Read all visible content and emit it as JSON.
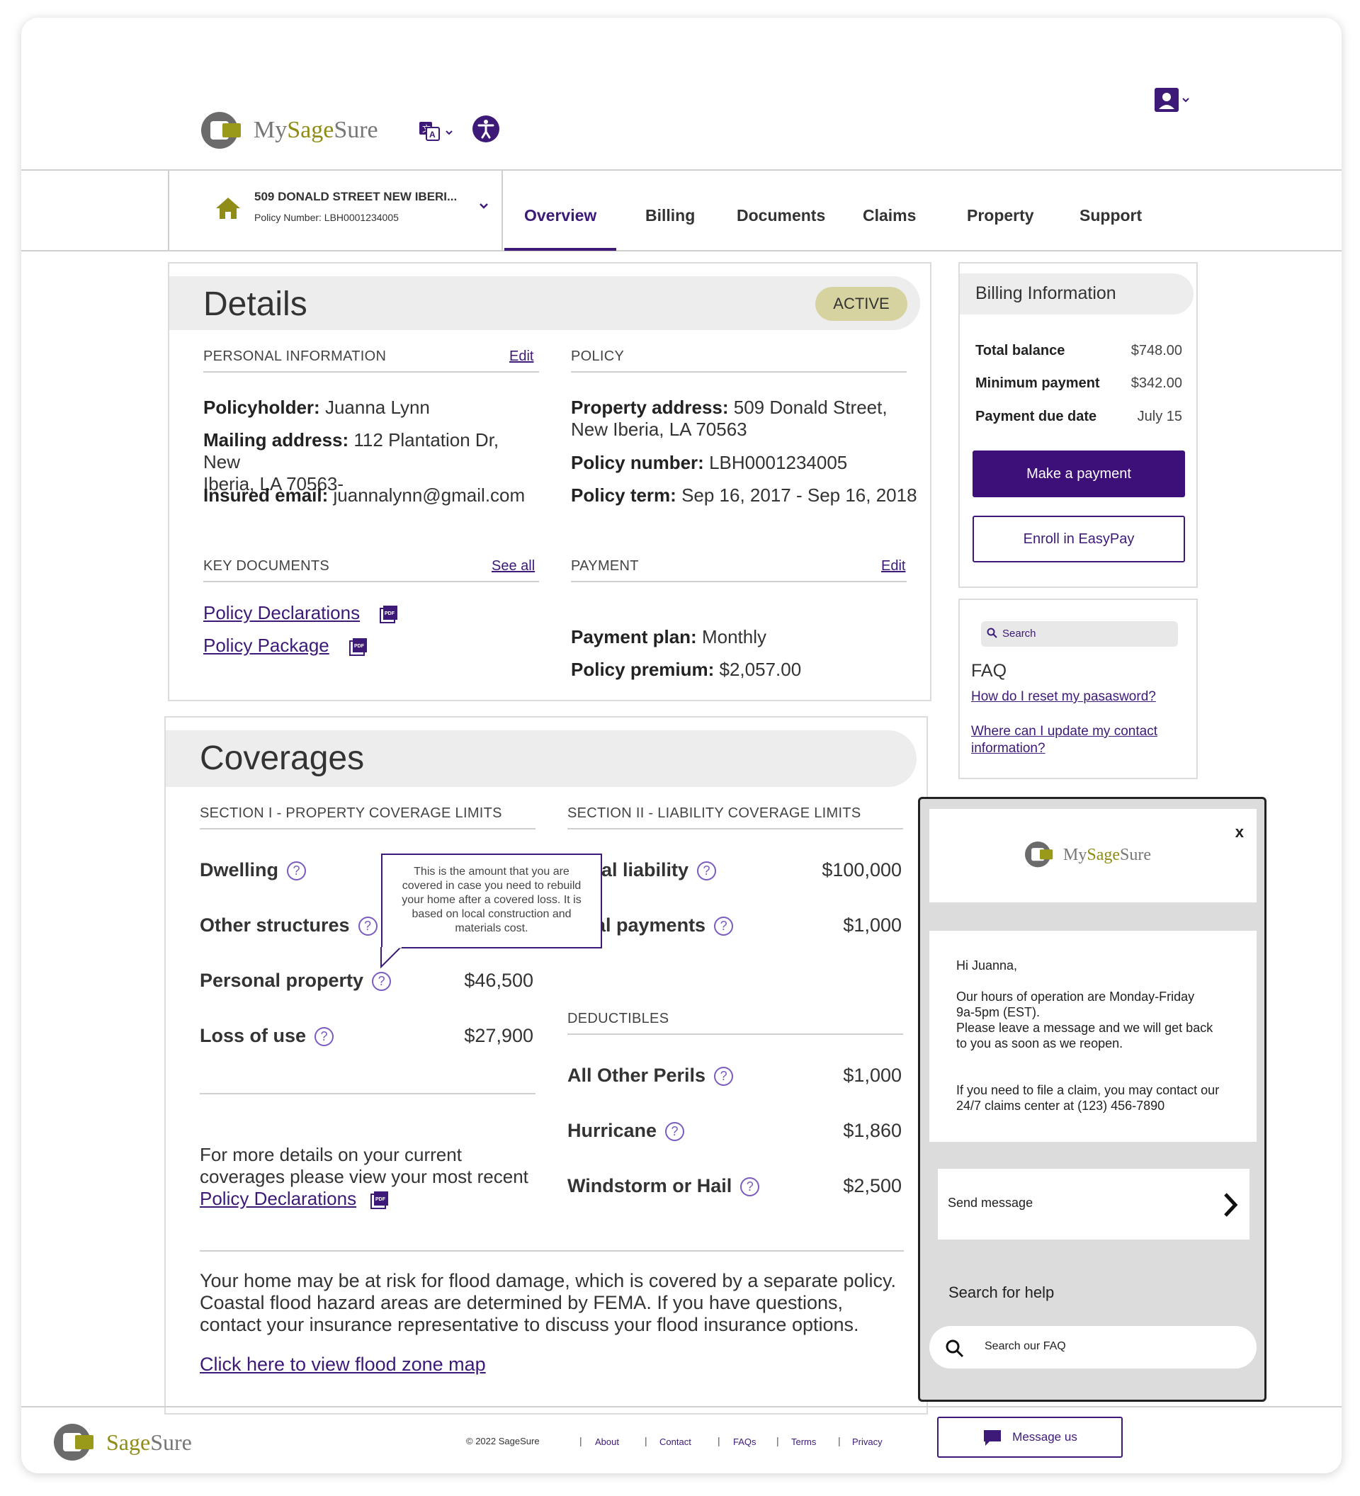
{
  "header": {
    "logo_my": "My",
    "logo_sage": "Sage",
    "logo_sure": "Sure"
  },
  "policy_selector": {
    "address": "509 DONALD STREET NEW IBERI...",
    "policy_number": "Policy Number: LBH0001234005"
  },
  "tabs": [
    {
      "label": "Overview",
      "active": true
    },
    {
      "label": "Billing"
    },
    {
      "label": "Documents"
    },
    {
      "label": "Claims"
    },
    {
      "label": "Property"
    },
    {
      "label": "Support"
    }
  ],
  "details": {
    "title": "Details",
    "status": "ACTIVE",
    "personal": {
      "heading": "PERSONAL INFORMATION",
      "edit": "Edit",
      "policyholder_label": "Policyholder:",
      "policyholder": "Juanna Lynn",
      "mailing_label": "Mailing address:",
      "mailing_1": "112 Plantation Dr, New",
      "mailing_2": "Iberia, LA 70563-",
      "email_label": "Insured email:",
      "email": "juannalynn@gmail.com"
    },
    "policy": {
      "heading": "POLICY",
      "address_label": "Property address:",
      "address_1": "509 Donald Street,",
      "address_2": "New Iberia, LA 70563",
      "number_label": "Policy number:",
      "number": "LBH0001234005",
      "term_label": "Policy term:",
      "term": "Sep 16, 2017 - Sep 16, 2018"
    },
    "key_documents": {
      "heading": "KEY DOCUMENTS",
      "see_all": "See all",
      "doc1": "Policy Declarations",
      "doc2": "Policy Package"
    },
    "payment": {
      "heading": "PAYMENT",
      "edit": "Edit",
      "plan_label": "Payment plan:",
      "plan": "Monthly",
      "premium_label": "Policy premium:",
      "premium": "$2,057.00"
    }
  },
  "billing": {
    "title": "Billing Information",
    "total_label": "Total balance",
    "total": "$748.00",
    "min_label": "Minimum payment",
    "min": "$342.00",
    "due_label": "Payment due date",
    "due": "July 15",
    "pay_button": "Make a payment",
    "easypay_button": "Enroll in EasyPay"
  },
  "faq": {
    "search_placeholder": "Search",
    "title": "FAQ",
    "q1": "How do I reset my pasasword?",
    "q2_1": "Where can I update my contact",
    "q2_2": "information?"
  },
  "coverages": {
    "title": "Coverages",
    "section1": "SECTION I - PROPERTY COVERAGE LIMITS",
    "section2": "SECTION II - LIABILITY COVERAGE LIMITS",
    "dwelling": "Dwelling",
    "other_structures": "Other structures",
    "personal_property": "Personal property",
    "personal_property_val": "$46,500",
    "loss_of_use": "Loss of use",
    "loss_of_use_val": "$27,900",
    "personal_liability": "sonal liability",
    "personal_liability_val": "$100,000",
    "medical_payments": "dical payments",
    "medical_payments_val": "$1,000",
    "deductibles": "DEDUCTIBLES",
    "aop": "All Other Perils",
    "aop_val": "$1,000",
    "hurricane": "Hurricane",
    "hurricane_val": "$1,860",
    "wind": "Windstorm or Hail",
    "wind_val": "$2,500",
    "tooltip": "This is the amount that you are covered in case you need to rebuild your home after a covered loss. It is based on local construction and materials cost.",
    "more_1": "For more details on your current",
    "more_2": "coverages please view your most recent",
    "more_link": "Policy Declarations",
    "flood_1": "Your home may be at risk for flood damage, which is covered by a separate policy.",
    "flood_2": "Coastal flood hazard areas are determined by FEMA. If you have questions,",
    "flood_3": "contact your insurance representative to discuss your flood insurance options.",
    "flood_link": "Click here to view flood zone map"
  },
  "chat": {
    "close": "x",
    "greeting": "Hi Juanna,",
    "hours_1": "Our hours of operation are Monday-Friday",
    "hours_2": "9a-5pm (EST).",
    "hours_3": "Please leave a message and we will get back",
    "hours_4": "to you as soon as we reopen.",
    "claim_1": "If you need to file a claim, you may contact our",
    "claim_2": "24/7 claims center at (123) 456-7890",
    "send": "Send message",
    "search_heading": "Search for help",
    "search_placeholder": "Search our FAQ"
  },
  "footer": {
    "logo_sage": "Sage",
    "logo_sure": "Sure",
    "copyright": "© 2022 SageSure",
    "links": [
      "About",
      "Contact",
      "FAQs",
      "Terms",
      "Privacy"
    ],
    "message_us": "Message us"
  }
}
